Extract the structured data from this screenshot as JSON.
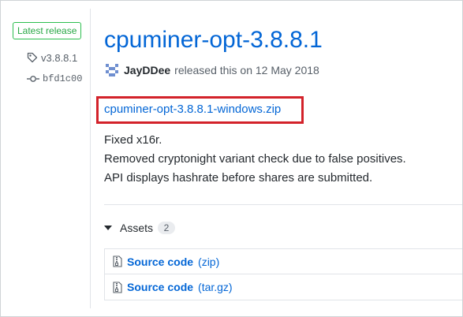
{
  "sidebar": {
    "badge": "Latest release",
    "tag": "v3.8.8.1",
    "commit": "bfd1c00",
    "icons": {
      "tag": "tag-icon",
      "commit": "git-commit-icon"
    }
  },
  "release": {
    "title": "cpuminer-opt-3.8.8.1",
    "author": "JayDDee",
    "released_text": "released this on 12 May 2018",
    "download_link": "cpuminer-opt-3.8.8.1-windows.zip",
    "notes": [
      "Fixed x16r.",
      "Removed cryptonight variant check due to false positives.",
      "API displays hashrate before shares are submitted."
    ]
  },
  "assets": {
    "label": "Assets",
    "count": "2",
    "items": [
      {
        "name": "Source code",
        "ext": "(zip)",
        "icon": "file-zip-icon"
      },
      {
        "name": "Source code",
        "ext": "(tar.gz)",
        "icon": "file-zip-icon"
      }
    ]
  },
  "colors": {
    "link": "#0366d6",
    "badge_green": "#28a745",
    "highlight_red": "#d3222a"
  }
}
